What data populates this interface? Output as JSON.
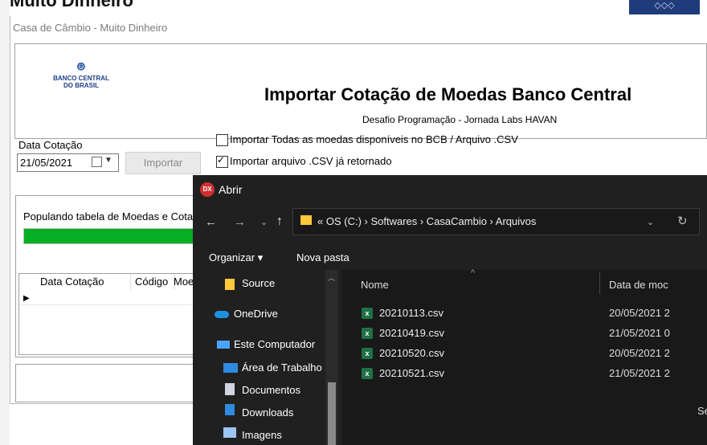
{
  "background": {
    "title_fragment": "Muito Dinheiro"
  },
  "main_window": {
    "title": "Casa de Câmbio - Muito Dinheiro",
    "logo": {
      "line1": "BANCO CENTRAL",
      "line2": "DO BRASIL"
    },
    "header_title": "Importar Cotação de Moedas Banco Central",
    "header_subtitle": "Desafio Programação - Jornada Labs HAVAN",
    "date_label": "Data Cotação",
    "date_value": "21/05/2021",
    "import_button": "Importar",
    "checkbox1": {
      "label": "Importar Todas as moedas disponíveis no BCB / Arquivo .CSV",
      "checked": false
    },
    "checkbox2": {
      "label": "Importar arquivo .CSV já retornado",
      "checked": true
    },
    "progress_label": "Populando tabela de Moedas e Cotaç",
    "progress_percent": 100,
    "grid_columns": [
      "Data Cotação",
      "Código",
      "Moeda"
    ]
  },
  "dialog": {
    "title": "Abrir",
    "icon_text": "DX",
    "address": "« OS (C:) › Softwares › CasaCambio › Arquivos",
    "toolbar": {
      "organize": "Organizar ▾",
      "new_folder": "Nova pasta"
    },
    "nav_items": [
      {
        "label": "Source",
        "icon": "folder-icon",
        "color": "#ffc83d"
      },
      {
        "label": "OneDrive",
        "icon": "cloud-icon",
        "color": "#1e90e0"
      },
      {
        "label": "Este Computador",
        "icon": "computer-icon",
        "color": "#4aa3ff"
      },
      {
        "label": "Área de Trabalho",
        "icon": "desktop-icon",
        "color": "#2f8ae0"
      },
      {
        "label": "Documentos",
        "icon": "document-icon",
        "color": "#cfd6e2"
      },
      {
        "label": "Downloads",
        "icon": "download-icon",
        "color": "#2f8ae0"
      },
      {
        "label": "Imagens",
        "icon": "image-icon",
        "color": "#9ac4f2"
      }
    ],
    "columns": {
      "name": "Nome",
      "date": "Data de moc"
    },
    "files": [
      {
        "name": "20210113.csv",
        "date": "20/05/2021 2"
      },
      {
        "name": "20210419.csv",
        "date": "21/05/2021 0"
      },
      {
        "name": "20210520.csv",
        "date": "20/05/2021 2"
      },
      {
        "name": "20210521.csv",
        "date": "21/05/2021 2"
      }
    ],
    "right_fragment": "Se"
  }
}
